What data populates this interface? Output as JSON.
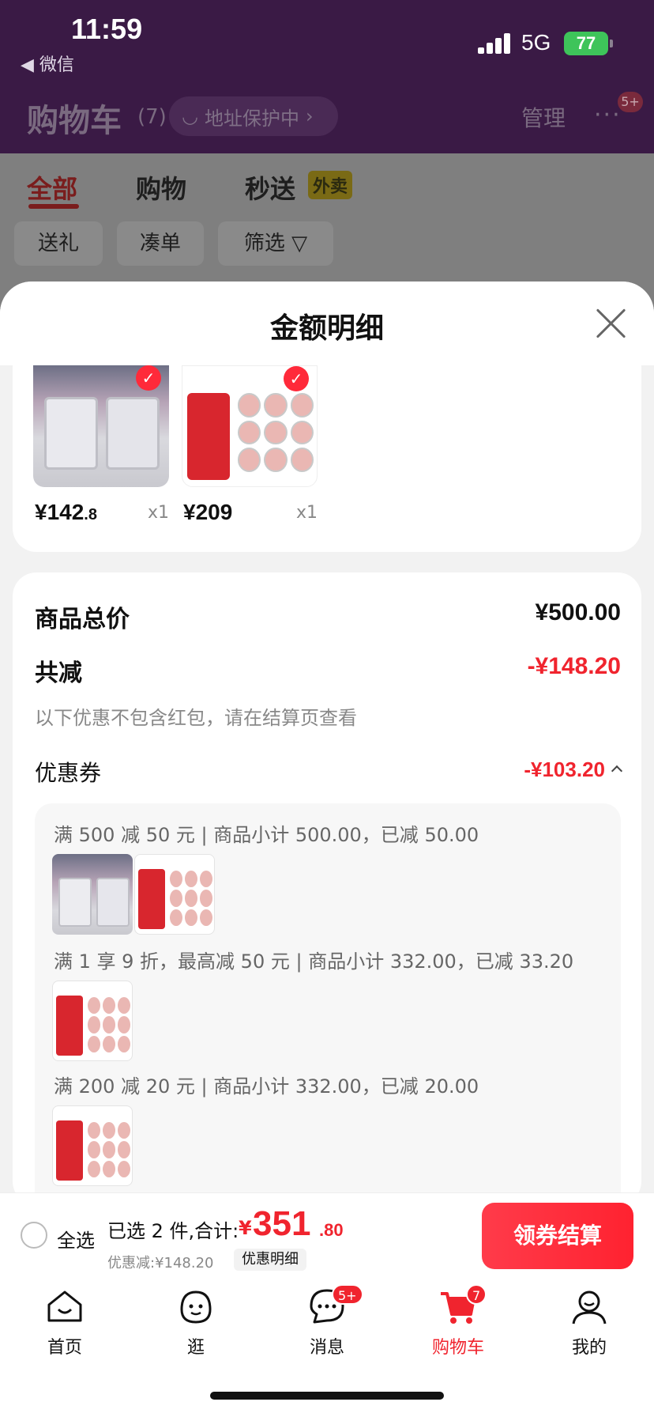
{
  "status_bar": {
    "time": "11:59",
    "back_app": "◀ 微信",
    "network": "5G",
    "battery": "77"
  },
  "header": {
    "title": "购物车",
    "count": "(7)",
    "address_protect": "地址保护中",
    "manage": "管理",
    "more_badge": "5+"
  },
  "tabs": [
    {
      "label": "全部"
    },
    {
      "label": "购物"
    },
    {
      "label": "秒送"
    }
  ],
  "waimai_tag": "外卖",
  "chips": [
    {
      "label": "送礼"
    },
    {
      "label": "凑单"
    },
    {
      "label": "筛选"
    }
  ],
  "sheet": {
    "title": "金额明细",
    "products": [
      {
        "price_int": "¥142",
        "price_dec": ".8",
        "qty": "x1",
        "image": "storage-trolley"
      },
      {
        "price_int": "¥209",
        "price_dec": "",
        "qty": "x1",
        "image": "pet-food-cans"
      }
    ],
    "summary": {
      "total_label": "商品总价",
      "total_value": "¥500.00",
      "reduce_label": "共减",
      "reduce_value": "-¥148.20",
      "note": "以下优惠不包含红包，请在结算页查看",
      "coupon_label": "优惠券",
      "coupon_value": "-¥103.20",
      "rules": [
        "满 500 减 50 元 | 商品小计 500.00，已减 50.00",
        "满 1 享 9 折，最高减 50 元 | 商品小计 332.00，已减 33.20",
        "满 200 减 20 元 | 商品小计 332.00，已减 20.00"
      ]
    }
  },
  "checkout": {
    "select_all": "全选",
    "selected": "已选 2 件,合计:",
    "total_symbol": "¥",
    "total_int": "351",
    "total_dec": ".80",
    "discount": "优惠减:¥148.20",
    "detail_button": "优惠明细",
    "checkout_button": "领券结算"
  },
  "tabbar": [
    {
      "label": "首页",
      "icon": "home-icon"
    },
    {
      "label": "逛",
      "icon": "face-icon"
    },
    {
      "label": "消息",
      "icon": "message-icon",
      "badge": "5+"
    },
    {
      "label": "购物车",
      "icon": "cart-icon",
      "badge": "7"
    },
    {
      "label": "我的",
      "icon": "person-icon"
    }
  ],
  "colors": {
    "accent": "#f0242e",
    "header_bg": "#3a1a45"
  }
}
